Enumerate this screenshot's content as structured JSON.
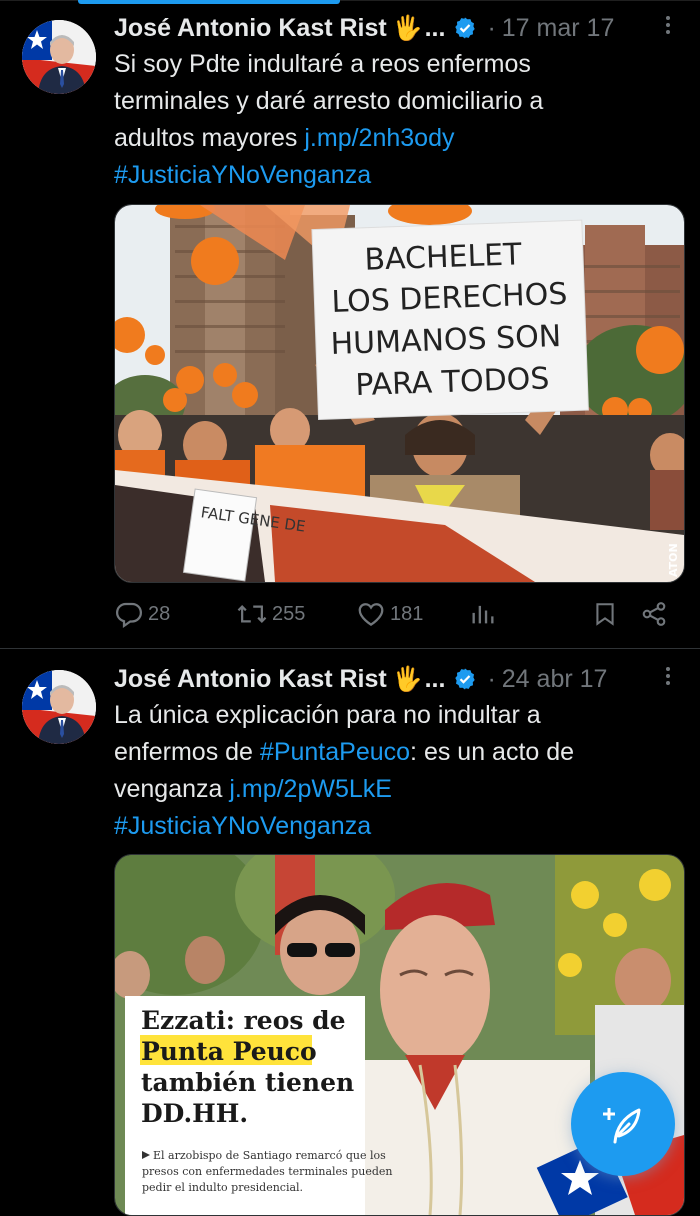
{
  "tweets": [
    {
      "author": "José Antonio Kast Rist",
      "emoji": "🖐",
      "ellipsis": "...",
      "separator": "·",
      "date": "17 mar 17",
      "text_lines": [
        "Si soy Pdte indultaré a reos enfermos",
        "terminales y daré arresto domiciliario a"
      ],
      "text_line3_prefix": "adultos mayores ",
      "link": "j.mp/2nh3ody",
      "hashtag_line": "#JusticiaYNoVenganza",
      "image": {
        "sign_lines": [
          "BACHELET",
          "LOS DERECHOS",
          "HUMANOS SON",
          "PARA TODOS"
        ],
        "banner_text": "FALT GENE DE",
        "watermark": "ATON"
      },
      "counts": {
        "replies": "28",
        "retweets": "255",
        "likes": "181"
      }
    },
    {
      "author": "José Antonio Kast Rist",
      "emoji": "🖐",
      "ellipsis": "...",
      "separator": "·",
      "date": "24 abr 17",
      "text_line1": "La única explicación para no indultar a",
      "text_line2_prefix": "enfermos de ",
      "text_line2_hashtag": "#PuntaPeuco",
      "text_line2_suffix": ": es un acto de",
      "text_line3_prefix": "venganza ",
      "link": "j.mp/2pW5LkE",
      "hashtag_line": "#JusticiaYNoVenganza",
      "image": {
        "headline_1": "Ezzati: reos de",
        "headline_highlight": "Punta Peuco",
        "headline_3": "también tienen",
        "headline_4": "DD.HH.",
        "caption_lines": [
          "El arzobispo de Santiago remarcó que los",
          "presos con enfermedades terminales pueden",
          "pedir el indulto presidencial."
        ]
      }
    }
  ],
  "colors": {
    "accent": "#1d9bf0",
    "muted": "#71767b",
    "background": "#000000",
    "text": "#e7e9ea",
    "highlight": "#ffe33b"
  },
  "icons": [
    "reply-icon",
    "retweet-icon",
    "like-icon",
    "views-icon",
    "bookmark-icon",
    "share-icon",
    "verified-icon",
    "compose-icon",
    "more-icon"
  ]
}
